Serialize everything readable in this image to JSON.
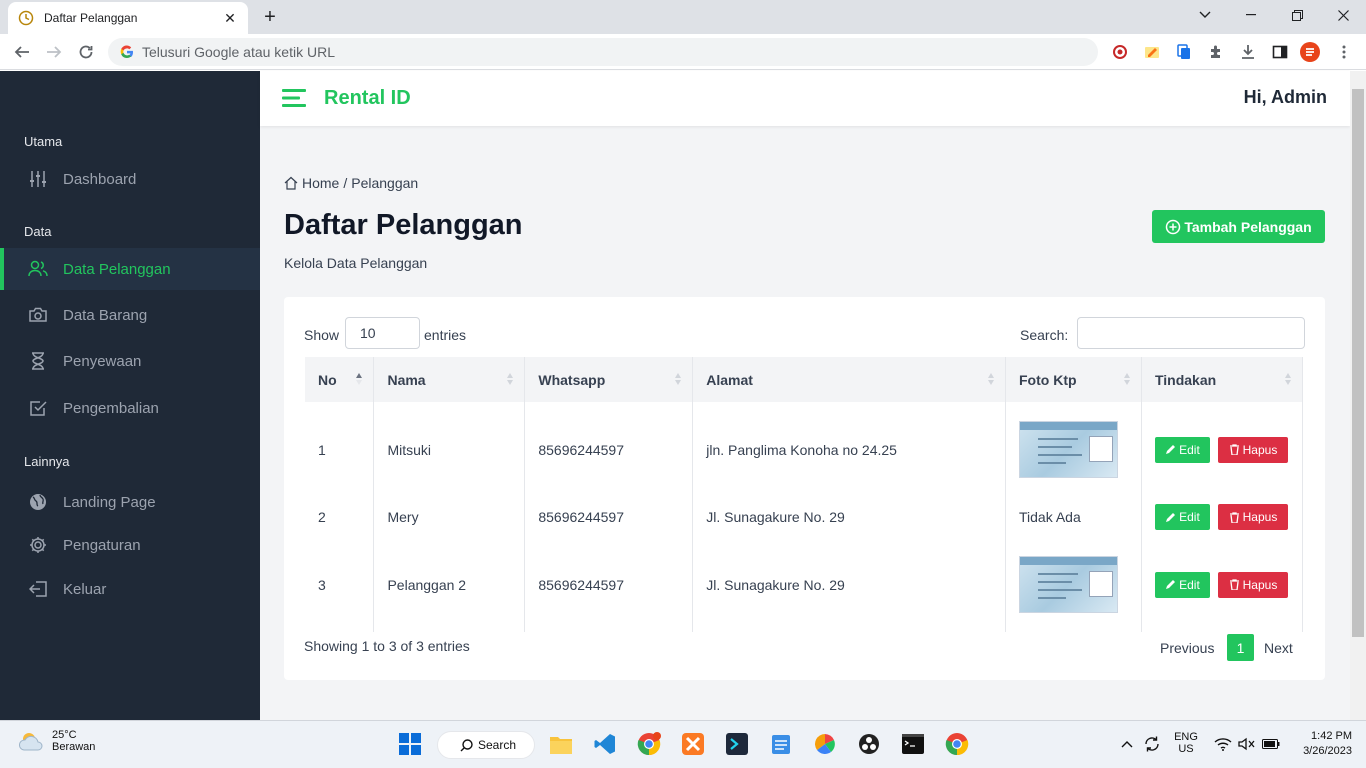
{
  "browser": {
    "tab_title": "Daftar Pelanggan",
    "new_tab_symbol": "+",
    "omnibox_placeholder": "Telusuri Google atau ketik URL"
  },
  "app": {
    "brand": "Rental ID",
    "greeting": "Hi, Admin",
    "accent_color": "#22c55e",
    "danger_color": "#dc2f43"
  },
  "sidebar": {
    "sections": [
      {
        "heading": "Utama"
      },
      {
        "heading": "Data"
      },
      {
        "heading": "Lainnya"
      }
    ],
    "items": [
      {
        "label": "Dashboard",
        "icon": "sliders-icon"
      },
      {
        "label": "Data Pelanggan",
        "icon": "users-icon",
        "active": true
      },
      {
        "label": "Data Barang",
        "icon": "camera-icon"
      },
      {
        "label": "Penyewaan",
        "icon": "hourglass-icon"
      },
      {
        "label": "Pengembalian",
        "icon": "check-square-icon"
      },
      {
        "label": "Landing Page",
        "icon": "globe-icon"
      },
      {
        "label": "Pengaturan",
        "icon": "gear-icon"
      },
      {
        "label": "Keluar",
        "icon": "logout-icon"
      }
    ]
  },
  "page": {
    "breadcrumb_home": "Home",
    "breadcrumb_sep": "/",
    "breadcrumb_current": "Pelanggan",
    "title": "Daftar Pelanggan",
    "subtitle": "Kelola Data Pelanggan",
    "add_button": "Tambah Pelanggan"
  },
  "table": {
    "show_label": "Show",
    "page_length": "10",
    "entries_label": "entries",
    "search_label": "Search:",
    "columns": [
      "No",
      "Nama",
      "Whatsapp",
      "Alamat",
      "Foto Ktp",
      "Tindakan"
    ],
    "rows": [
      {
        "no": "1",
        "nama": "Mitsuki",
        "whatsapp": "85696244597",
        "alamat": "jln. Panglima Konoha no 24.25",
        "foto": "image",
        "foto_text": ""
      },
      {
        "no": "2",
        "nama": "Mery",
        "whatsapp": "85696244597",
        "alamat": "Jl. Sunagakure No. 29",
        "foto": "text",
        "foto_text": "Tidak Ada"
      },
      {
        "no": "3",
        "nama": "Pelanggan 2",
        "whatsapp": "85696244597",
        "alamat": "Jl. Sunagakure No. 29",
        "foto": "image",
        "foto_text": ""
      }
    ],
    "edit_label": "Edit",
    "delete_label": "Hapus",
    "info": "Showing 1 to 3 of 3 entries",
    "prev_label": "Previous",
    "current_page": "1",
    "next_label": "Next"
  },
  "taskbar": {
    "weather_temp": "25°C",
    "weather_desc": "Berawan",
    "search_label": "Search",
    "lang_top": "ENG",
    "lang_bottom": "US",
    "time": "1:42 PM",
    "date": "3/26/2023"
  }
}
